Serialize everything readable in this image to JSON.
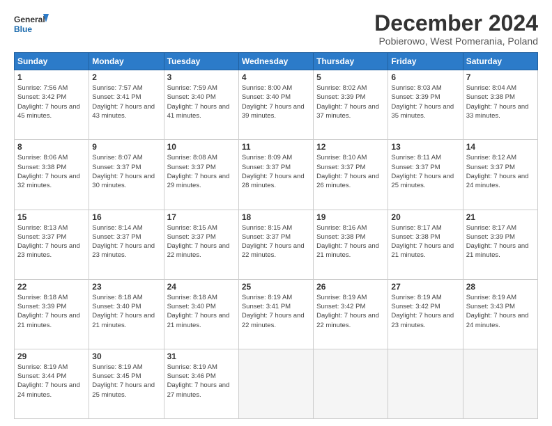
{
  "logo": {
    "line1": "General",
    "line2": "Blue"
  },
  "title": "December 2024",
  "subtitle": "Pobierowo, West Pomerania, Poland",
  "weekdays": [
    "Sunday",
    "Monday",
    "Tuesday",
    "Wednesday",
    "Thursday",
    "Friday",
    "Saturday"
  ],
  "weeks": [
    [
      {
        "day": 1,
        "sunrise": "7:56 AM",
        "sunset": "3:42 PM",
        "daylight": "7 hours and 45 minutes."
      },
      {
        "day": 2,
        "sunrise": "7:57 AM",
        "sunset": "3:41 PM",
        "daylight": "7 hours and 43 minutes."
      },
      {
        "day": 3,
        "sunrise": "7:59 AM",
        "sunset": "3:40 PM",
        "daylight": "7 hours and 41 minutes."
      },
      {
        "day": 4,
        "sunrise": "8:00 AM",
        "sunset": "3:40 PM",
        "daylight": "7 hours and 39 minutes."
      },
      {
        "day": 5,
        "sunrise": "8:02 AM",
        "sunset": "3:39 PM",
        "daylight": "7 hours and 37 minutes."
      },
      {
        "day": 6,
        "sunrise": "8:03 AM",
        "sunset": "3:39 PM",
        "daylight": "7 hours and 35 minutes."
      },
      {
        "day": 7,
        "sunrise": "8:04 AM",
        "sunset": "3:38 PM",
        "daylight": "7 hours and 33 minutes."
      }
    ],
    [
      {
        "day": 8,
        "sunrise": "8:06 AM",
        "sunset": "3:38 PM",
        "daylight": "7 hours and 32 minutes."
      },
      {
        "day": 9,
        "sunrise": "8:07 AM",
        "sunset": "3:37 PM",
        "daylight": "7 hours and 30 minutes."
      },
      {
        "day": 10,
        "sunrise": "8:08 AM",
        "sunset": "3:37 PM",
        "daylight": "7 hours and 29 minutes."
      },
      {
        "day": 11,
        "sunrise": "8:09 AM",
        "sunset": "3:37 PM",
        "daylight": "7 hours and 28 minutes."
      },
      {
        "day": 12,
        "sunrise": "8:10 AM",
        "sunset": "3:37 PM",
        "daylight": "7 hours and 26 minutes."
      },
      {
        "day": 13,
        "sunrise": "8:11 AM",
        "sunset": "3:37 PM",
        "daylight": "7 hours and 25 minutes."
      },
      {
        "day": 14,
        "sunrise": "8:12 AM",
        "sunset": "3:37 PM",
        "daylight": "7 hours and 24 minutes."
      }
    ],
    [
      {
        "day": 15,
        "sunrise": "8:13 AM",
        "sunset": "3:37 PM",
        "daylight": "7 hours and 23 minutes."
      },
      {
        "day": 16,
        "sunrise": "8:14 AM",
        "sunset": "3:37 PM",
        "daylight": "7 hours and 23 minutes."
      },
      {
        "day": 17,
        "sunrise": "8:15 AM",
        "sunset": "3:37 PM",
        "daylight": "7 hours and 22 minutes."
      },
      {
        "day": 18,
        "sunrise": "8:15 AM",
        "sunset": "3:37 PM",
        "daylight": "7 hours and 22 minutes."
      },
      {
        "day": 19,
        "sunrise": "8:16 AM",
        "sunset": "3:38 PM",
        "daylight": "7 hours and 21 minutes."
      },
      {
        "day": 20,
        "sunrise": "8:17 AM",
        "sunset": "3:38 PM",
        "daylight": "7 hours and 21 minutes."
      },
      {
        "day": 21,
        "sunrise": "8:17 AM",
        "sunset": "3:39 PM",
        "daylight": "7 hours and 21 minutes."
      }
    ],
    [
      {
        "day": 22,
        "sunrise": "8:18 AM",
        "sunset": "3:39 PM",
        "daylight": "7 hours and 21 minutes."
      },
      {
        "day": 23,
        "sunrise": "8:18 AM",
        "sunset": "3:40 PM",
        "daylight": "7 hours and 21 minutes."
      },
      {
        "day": 24,
        "sunrise": "8:18 AM",
        "sunset": "3:40 PM",
        "daylight": "7 hours and 21 minutes."
      },
      {
        "day": 25,
        "sunrise": "8:19 AM",
        "sunset": "3:41 PM",
        "daylight": "7 hours and 22 minutes."
      },
      {
        "day": 26,
        "sunrise": "8:19 AM",
        "sunset": "3:42 PM",
        "daylight": "7 hours and 22 minutes."
      },
      {
        "day": 27,
        "sunrise": "8:19 AM",
        "sunset": "3:42 PM",
        "daylight": "7 hours and 23 minutes."
      },
      {
        "day": 28,
        "sunrise": "8:19 AM",
        "sunset": "3:43 PM",
        "daylight": "7 hours and 24 minutes."
      }
    ],
    [
      {
        "day": 29,
        "sunrise": "8:19 AM",
        "sunset": "3:44 PM",
        "daylight": "7 hours and 24 minutes."
      },
      {
        "day": 30,
        "sunrise": "8:19 AM",
        "sunset": "3:45 PM",
        "daylight": "7 hours and 25 minutes."
      },
      {
        "day": 31,
        "sunrise": "8:19 AM",
        "sunset": "3:46 PM",
        "daylight": "7 hours and 27 minutes."
      },
      null,
      null,
      null,
      null
    ]
  ]
}
